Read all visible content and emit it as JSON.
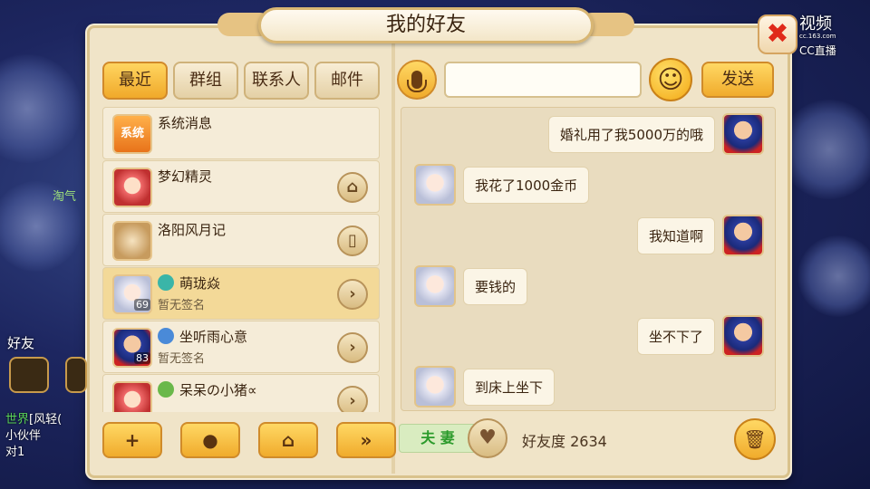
{
  "window": {
    "title": "我的好友",
    "close_icon": "close-x-icon"
  },
  "watermark": {
    "brand": "CC直播",
    "sub": "cc.163.com",
    "top_text": "视频"
  },
  "tabs": [
    {
      "label": "最近",
      "active": true
    },
    {
      "label": "群组"
    },
    {
      "label": "联系人"
    },
    {
      "label": "邮件"
    }
  ],
  "contacts": [
    {
      "name": "系统消息",
      "icon": "系统",
      "type": "system"
    },
    {
      "name": "梦幻精灵",
      "action_icon": "home-icon"
    },
    {
      "name": "洛阳风月记",
      "action_icon": "book-icon"
    },
    {
      "name": "萌珑焱",
      "status": "暂无签名",
      "level": "69",
      "selected": true,
      "action_icon": "chevron-right-icon"
    },
    {
      "name": "坐听雨心意",
      "status": "暂无签名",
      "level": "83",
      "action_icon": "chevron-right-icon"
    },
    {
      "name": "呆呆の小猪∝",
      "action_icon": "chevron-right-icon"
    }
  ],
  "bottom_actions": [
    {
      "name": "add-friend",
      "icon": "add-person-icon"
    },
    {
      "name": "message",
      "icon": "speech-bubble-icon"
    },
    {
      "name": "home",
      "icon": "home-icon"
    },
    {
      "name": "more",
      "icon": "double-chevron-icon"
    }
  ],
  "composer": {
    "placeholder": "",
    "send_label": "发送"
  },
  "messages": [
    {
      "from": "me",
      "text": "婚礼用了我5000万的哦"
    },
    {
      "from": "other",
      "text": "我花了1000金币"
    },
    {
      "from": "me",
      "text": "我知道啊"
    },
    {
      "from": "other",
      "text": "要钱的"
    },
    {
      "from": "me",
      "text": "坐不下了"
    },
    {
      "from": "other",
      "text": "到床上坐下"
    }
  ],
  "relationship": {
    "label": "夫 妻",
    "favor_label": "好友度",
    "favor_value": "2634"
  },
  "side": {
    "friend_label": "好友",
    "chat_channel": "世界",
    "chat_text": "[风轻(",
    "line2": "小伙伴",
    "line3": "对1",
    "left_name": "淘气"
  }
}
